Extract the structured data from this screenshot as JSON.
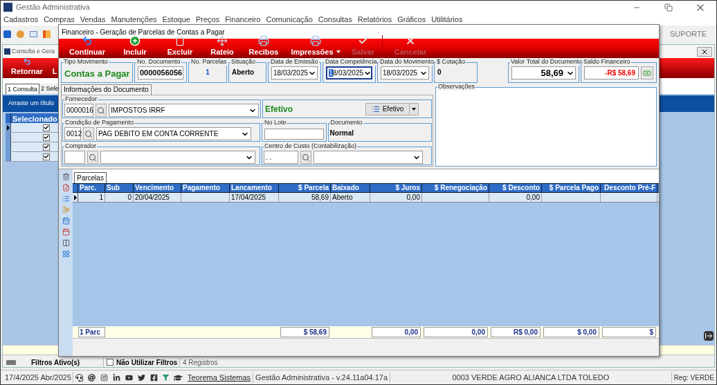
{
  "app": {
    "title": "Gestão Administrativa",
    "support": "SUPORTE"
  },
  "menu": [
    "Cadastros",
    "Compras",
    "Vendas",
    "Manutenções",
    "Estoque",
    "Preços",
    "Financeiro",
    "Comunicação",
    "Consultas",
    "Relatórios",
    "Gráficos",
    "Utilitários"
  ],
  "back_window": {
    "title": "Consulta e Gera",
    "toolbar": [
      "Retornar",
      "L"
    ],
    "tabs": [
      {
        "label": "1 Consulta",
        "selected": true
      },
      {
        "label": "2 Sele",
        "selected": false
      }
    ],
    "group_hint": "Arraste um título",
    "column": "Selecionado",
    "rows": [
      {
        "checked": true,
        "current": true
      },
      {
        "checked": true,
        "current": false
      },
      {
        "checked": true,
        "current": false
      },
      {
        "checked": true,
        "current": false
      }
    ],
    "filters": {
      "label": "Filtros Ativo(s)",
      "option": "Não Utilizar Filtros",
      "option_checked": false,
      "count": "4 Registros"
    }
  },
  "dialog": {
    "title": "Financeiro - Geração de Parcelas de Contas a Pagar",
    "toolbar": [
      {
        "label": "Continuar",
        "disabled": false,
        "menu": false
      },
      {
        "label": "Incluir",
        "disabled": false,
        "menu": false
      },
      {
        "label": "Excluir",
        "disabled": false,
        "menu": false
      },
      {
        "label": "Rateio",
        "disabled": false,
        "menu": false
      },
      {
        "label": "Recibos",
        "disabled": false,
        "menu": false
      },
      {
        "label": "Impressões",
        "disabled": false,
        "menu": true
      },
      {
        "label": "Salvar",
        "disabled": true,
        "menu": false
      },
      {
        "label": "Cancelar",
        "disabled": true,
        "menu": false
      }
    ],
    "header": [
      {
        "label": "Tipo Movimento",
        "kind": "label",
        "value": "Contas a Pagar"
      },
      {
        "label": "No. Documento",
        "kind": "input",
        "value": "0000056056",
        "focused": false
      },
      {
        "label": "No. Parcelas",
        "kind": "label",
        "value": "1"
      },
      {
        "label": "Situação",
        "kind": "label",
        "value": "Aberto"
      },
      {
        "label": "Data de Emissão",
        "kind": "dropdown",
        "value": "18/03/2025",
        "focused": false
      },
      {
        "label": "Data Competência",
        "kind": "dropdown",
        "value": "18/03/2025",
        "focused": true
      },
      {
        "label": "Data do Movimento",
        "kind": "dropdown",
        "value": "18/03/2025",
        "focused": false
      },
      {
        "label": "$ Cotação",
        "kind": "label",
        "value": "0"
      },
      {
        "label": "Valor Total do Documento",
        "kind": "dropdown",
        "value": "58,69",
        "focused": false
      },
      {
        "label": "Saldo Financeiro",
        "kind": "money",
        "value": "-R$ 58,69"
      }
    ],
    "info_tab": "Informações do Documento",
    "fornecedor": {
      "label": "Fornecedor",
      "code": "0000016",
      "name": "IMPOSTOS IRRF"
    },
    "status": {
      "text": "Efetivo",
      "button": "Efetivo"
    },
    "condicao": {
      "label": "Condição de Pagamento",
      "code": "0012",
      "name": "PAG DEBITO EM CONTA CORRENTE"
    },
    "lote": {
      "label": "No Lote"
    },
    "documento": {
      "label": "Documento",
      "value": "Normal"
    },
    "comprador": {
      "label": "Comprador"
    },
    "centro": {
      "label": "Centro de Custo (Contabilização)",
      "code": ". ."
    },
    "observacoes": {
      "label": "Observações"
    },
    "grid_tab": "Parcelas",
    "columns": [
      "Parc.",
      "Sub",
      "Vencimento",
      "Pagamento",
      "Lancamento",
      "$ Parcela",
      "Baixado",
      "$ Juros",
      "$ Renegociação",
      "$ Desconto",
      "$ Parcela Pago",
      "Desconto Pré-F"
    ],
    "rows": [
      {
        "current": true,
        "cells": [
          "1",
          "0",
          "20/04/2025",
          null,
          "17/04/2025",
          "58,69",
          "Aberto",
          "0,00",
          null,
          "0,00",
          null,
          null
        ]
      }
    ],
    "totals": [
      "1 Parc",
      "$ 58,69",
      "0,00",
      "0,00",
      "R$ 0,00",
      "$ 0,00",
      "$"
    ]
  },
  "status_bar": {
    "date": "17/4/2025 Abr/2025",
    "link": "Teorema Sistemas",
    "version": "Gestão Administrativa - v.24.11a04.17a",
    "company": "0003 VERDE AGRO ALIANCA LTDA TOLEDO",
    "reg": "Reg: VERDE"
  }
}
